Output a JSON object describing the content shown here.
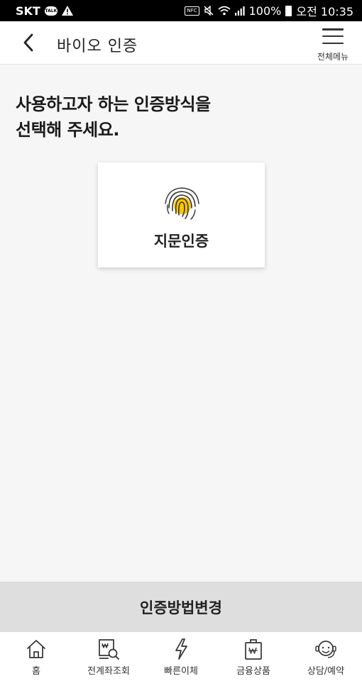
{
  "status_bar": {
    "carrier": "SKT",
    "talk_badge": "TALK",
    "nfc_label": "NFC",
    "battery": "100%",
    "time": "오전 10:35"
  },
  "header": {
    "title": "바이오 인증",
    "menu_label": "전체메뉴"
  },
  "main": {
    "heading_line1": "사용하고자 하는 인증방식을",
    "heading_line2": "선택해 주세요.",
    "methods": [
      {
        "label": "지문인증",
        "icon": "fingerprint-icon",
        "icon_color": "#ffc600"
      }
    ]
  },
  "change_method_label": "인증방법변경",
  "bottom_nav": [
    {
      "label": "홈",
      "icon": "home-icon"
    },
    {
      "label": "전계좌조회",
      "icon": "account-search-icon"
    },
    {
      "label": "빠른이체",
      "icon": "lightning-icon"
    },
    {
      "label": "금융상품",
      "icon": "bag-icon"
    },
    {
      "label": "상담/예약",
      "icon": "headset-icon"
    }
  ],
  "colors": {
    "accent": "#ffc600",
    "background": "#f6f6f6",
    "change_bar": "#dedede"
  }
}
